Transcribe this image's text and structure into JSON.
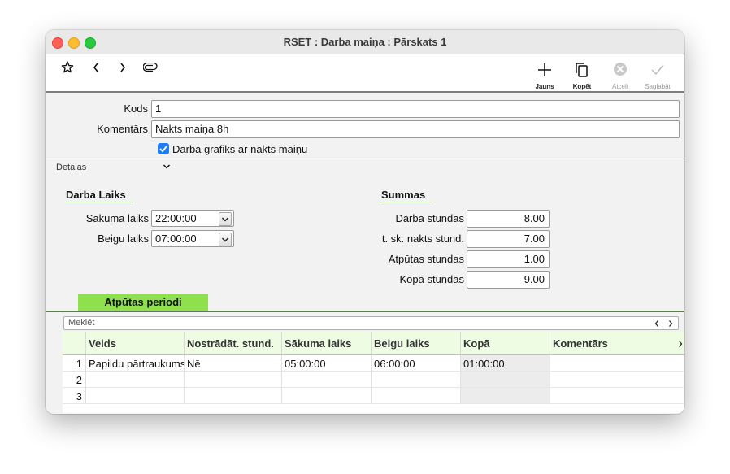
{
  "window": {
    "title": "RSET : Darba maiņa : Pārskats 1"
  },
  "toolbar": {
    "new_label": "Jauns",
    "copy_label": "Kopēt",
    "cancel_label": "Atcelt",
    "save_label": "Saglabāt"
  },
  "form": {
    "kods_label": "Kods",
    "kods_value": "1",
    "komentars_label": "Komentārs",
    "komentars_value": "Nakts maiņa 8h",
    "checkbox_label": "Darba grafiks ar nakts maiņu",
    "checkbox_checked": true
  },
  "details": {
    "label": "Detaļas"
  },
  "darba_laiks": {
    "heading": "Darba Laiks",
    "start_label": "Sākuma laiks",
    "start_value": "22:00:00",
    "end_label": "Beigu laiks",
    "end_value": "07:00:00"
  },
  "summas": {
    "heading": "Summas",
    "rows": [
      {
        "label": "Darba stundas",
        "value": "8.00"
      },
      {
        "label": "t. sk. nakts stund.",
        "value": "7.00"
      },
      {
        "label": "Atpūtas stundas",
        "value": "1.00"
      },
      {
        "label": "Kopā stundas",
        "value": "9.00"
      }
    ]
  },
  "tab": {
    "label": "Atpūtas periodi"
  },
  "search": {
    "placeholder": "Meklēt"
  },
  "table": {
    "columns": [
      "Veids",
      "Nostrādāt. stund.",
      "Sākuma laiks",
      "Beigu laiks",
      "Kopā",
      "Komentārs"
    ],
    "rows": [
      {
        "n": "1",
        "cells": [
          "Papildu pārtraukums",
          "Nē",
          "05:00:00",
          "06:00:00",
          "01:00:00",
          ""
        ]
      },
      {
        "n": "2",
        "cells": [
          "",
          "",
          "",
          "",
          "",
          ""
        ]
      },
      {
        "n": "3",
        "cells": [
          "",
          "",
          "",
          "",
          "",
          ""
        ]
      }
    ]
  },
  "colors": {
    "accent_green": "#77c34a",
    "tab_green": "#8ee04f",
    "header_tint": "#eefce4",
    "checkbox_blue": "#1f7cf5"
  }
}
